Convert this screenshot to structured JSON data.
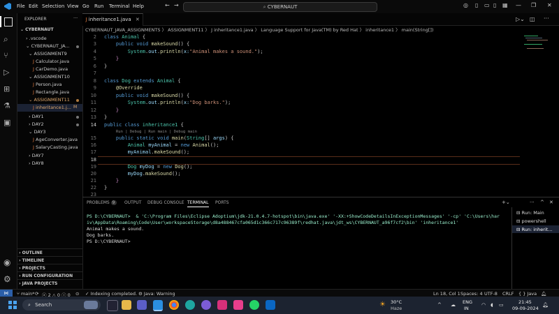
{
  "menu": [
    "File",
    "Edit",
    "Selection",
    "View",
    "Go",
    "Run",
    "Terminal",
    "Help"
  ],
  "search": {
    "value": "CYBERNAUT"
  },
  "explorer": {
    "title": "EXPLORER",
    "root": "CYBERNAUT",
    "items": [
      {
        "label": ".vscode"
      },
      {
        "label": "CYBERNAUT_JA..."
      },
      {
        "label": "ASSIGNMENT9"
      },
      {
        "label": "Calculator.java"
      },
      {
        "label": "CarDemo.java"
      },
      {
        "label": "ASSIGNMENT10"
      },
      {
        "label": "Person.java"
      },
      {
        "label": "Rectangle.java"
      },
      {
        "label": "ASSIGNMENT11"
      },
      {
        "label": "inheritance1.j..."
      },
      {
        "label": "DAY1"
      },
      {
        "label": "DAY2"
      },
      {
        "label": "DAY3"
      },
      {
        "label": "AgeConverter.java"
      },
      {
        "label": "SalaryCasting.java"
      },
      {
        "label": "DAY7"
      },
      {
        "label": "DAY8"
      }
    ],
    "sections": [
      "OUTLINE",
      "TIMELINE",
      "PROJECTS",
      "RUN CONFIGURATION",
      "JAVA PROJECTS"
    ]
  },
  "tab": {
    "label": "inheritance1.java"
  },
  "breadcrumbs": "CYBERNAUT_JAVA_ASSIGNMENTS 〉 ASSIGNMENT11 〉 J inheritance1.java 〉 Language Support for Java(TM) by Red Hat 〉 inheritance1 〉 main(String[])",
  "code": {
    "line_numbers": [
      "2",
      "3",
      "4",
      "5",
      "6",
      "7",
      "8",
      "9",
      "10",
      "11",
      "12",
      "13",
      "14",
      "15",
      "16",
      "17",
      "18",
      "19",
      "20",
      "21",
      "22",
      "23"
    ],
    "codelens": "Run | Debug | Run main | Debug main"
  },
  "panel": {
    "tabs": [
      "PROBLEMS",
      "OUTPUT",
      "DEBUG CONSOLE",
      "TERMINAL",
      "PORTS"
    ],
    "problems_count": "9",
    "terminal_lines": [
      "PS D:\\CYBERNAUT>  & 'C:\\Program Files\\Eclipse Adoptium\\jdk-21.0.4.7-hotspot\\bin\\java.exe' '-XX:+ShowCodeDetailsInExceptionMessages' '-cp' 'C:\\Users\\har",
      "iv\\AppData\\Roaming\\Code\\User\\workspaceStorage\\d8a488467cfa065d1c366c717c96389f\\redhat.java\\jdt_ws\\CYBERNAUT_a96f7cf2\\bin' 'inheritance1'",
      "Animal makes a sound.",
      "Dog barks.",
      "PS D:\\CYBERNAUT>"
    ],
    "terminals": [
      "Run: Main",
      "powershell",
      "Run: inherit..."
    ]
  },
  "status": {
    "branch": "main*",
    "errors": "2",
    "warnings": "0",
    "info": "0",
    "indexing": "Indexing completed.",
    "java": "Java: Warning",
    "position": "Ln 18, Col 1",
    "spaces": "Spaces: 4",
    "encoding": "UTF-8",
    "eol": "CRLF",
    "lang": "Java"
  },
  "taskbar": {
    "search": "Search",
    "weather_temp": "30°C",
    "weather_desc": "Haze",
    "lang1": "ENG",
    "lang2": "IN",
    "time": "21:45",
    "date": "09-09-2024"
  }
}
